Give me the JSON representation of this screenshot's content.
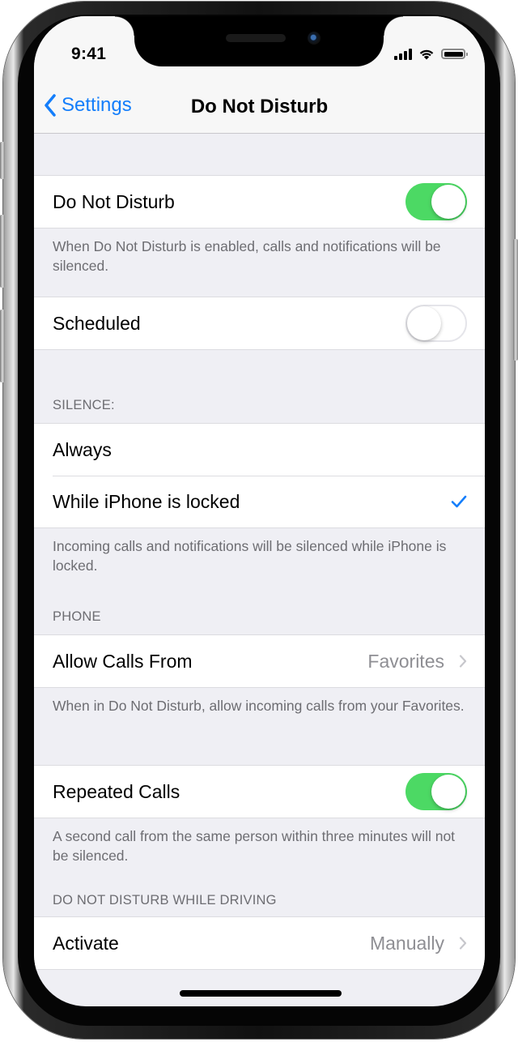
{
  "status_bar": {
    "time": "9:41",
    "icons": [
      "cellular-signal-icon",
      "wifi-icon",
      "battery-icon"
    ]
  },
  "nav": {
    "back_label": "Settings",
    "back_icon": "chevron-left-icon",
    "title": "Do Not Disturb"
  },
  "colors": {
    "accent": "#147efb",
    "toggle_on": "#4cd964",
    "background": "#efeff4",
    "secondary_text": "#6d6d72",
    "value_text": "#8e8e93"
  },
  "sections": {
    "dnd": {
      "label": "Do Not Disturb",
      "toggle_on": true,
      "footer": "When Do Not Disturb is enabled, calls and notifications will be silenced."
    },
    "scheduled": {
      "label": "Scheduled",
      "toggle_on": false
    },
    "silence": {
      "header": "SILENCE:",
      "options": [
        {
          "label": "Always",
          "selected": false
        },
        {
          "label": "While iPhone is locked",
          "selected": true
        }
      ],
      "footer": "Incoming calls and notifications will be silenced while iPhone is locked."
    },
    "phone": {
      "header": "PHONE",
      "allow_calls": {
        "label": "Allow Calls From",
        "value": "Favorites"
      },
      "footer": "When in Do Not Disturb, allow incoming calls from your Favorites."
    },
    "repeated": {
      "label": "Repeated Calls",
      "toggle_on": true,
      "footer": "A second call from the same person within three minutes will not be silenced."
    },
    "driving": {
      "header": "DO NOT DISTURB WHILE DRIVING",
      "activate": {
        "label": "Activate",
        "value": "Manually"
      }
    }
  }
}
